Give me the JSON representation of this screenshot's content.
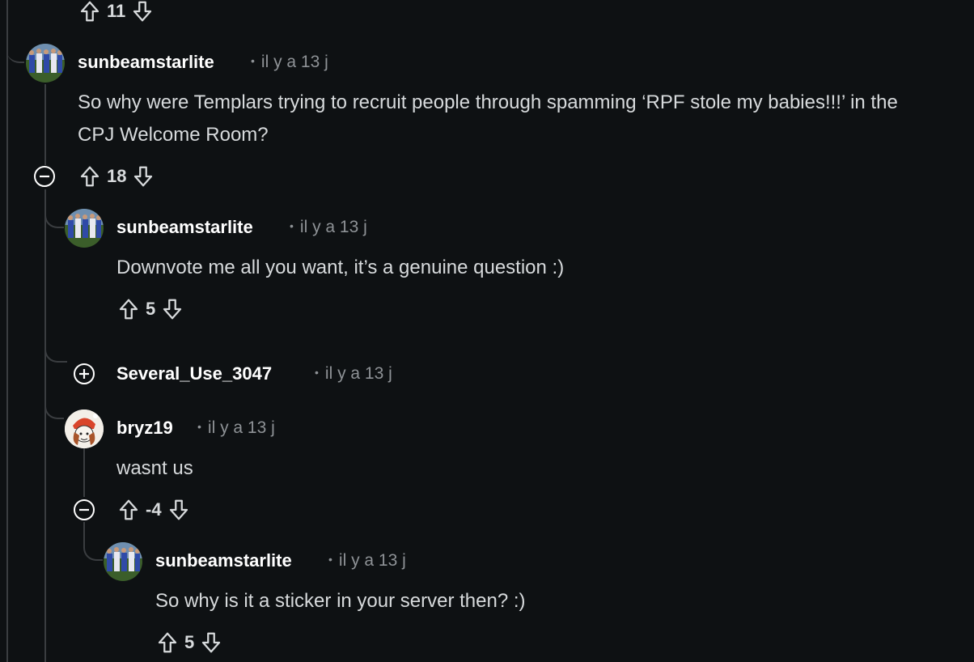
{
  "top_vote": {
    "count": "11"
  },
  "comments": [
    {
      "username": "sunbeamstarlite",
      "time": "il y a 13 j",
      "body": "So why were Templars trying to recruit people through spamming ‘RPF stole my babies!!!’ in the CPJ Welcome Room?",
      "votes": "18"
    },
    {
      "username": "sunbeamstarlite",
      "time": "il y a 13 j",
      "body": "Downvote me all you want, it’s a genuine question :)",
      "votes": "5"
    },
    {
      "username": "Several_Use_3047",
      "time": "il y a 13 j"
    },
    {
      "username": "bryz19",
      "time": "il y a 13 j",
      "body": "wasnt us",
      "votes": "-4"
    },
    {
      "username": "sunbeamstarlite",
      "time": "il y a 13 j",
      "body": "So why is it a sticker in your server then? :)",
      "votes": "5"
    }
  ],
  "icons": {
    "upvote": "upvote-arrow-icon",
    "downvote": "downvote-arrow-icon",
    "collapse": "collapse-minus-icon",
    "expand": "expand-plus-icon"
  },
  "colors": {
    "background": "#0e1113",
    "thread_line": "#3a3d40",
    "text": "#d7dadc",
    "meta": "#8e9296"
  }
}
